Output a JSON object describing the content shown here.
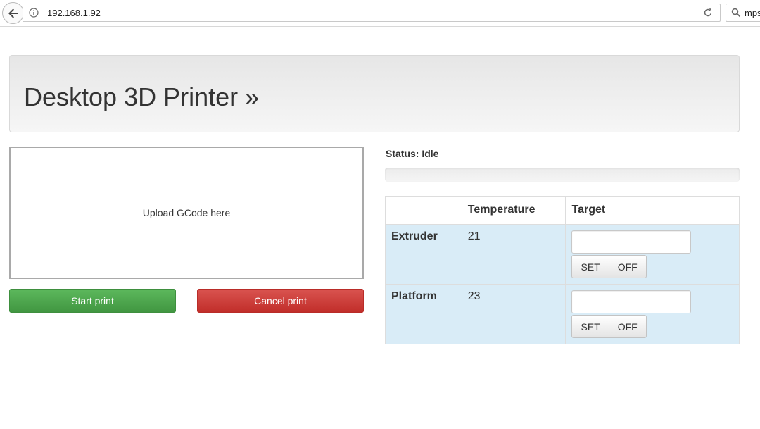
{
  "browser": {
    "url": "192.168.1.92",
    "search_text": "mps"
  },
  "header": {
    "title": "Desktop 3D Printer »"
  },
  "upload": {
    "label": "Upload GCode here"
  },
  "actions": {
    "start_label": "Start print",
    "cancel_label": "Cancel print"
  },
  "status": {
    "text": "Status: Idle",
    "progress_percent": 0
  },
  "table": {
    "headers": [
      "",
      "Temperature",
      "Target"
    ],
    "rows": [
      {
        "name": "Extruder",
        "temperature": "21",
        "target_value": "",
        "set_label": "SET",
        "off_label": "OFF"
      },
      {
        "name": "Platform",
        "temperature": "23",
        "target_value": "",
        "set_label": "SET",
        "off_label": "OFF"
      }
    ]
  },
  "colors": {
    "start": "#5cb85c",
    "cancel": "#d9534f",
    "row_info": "#d9ecf7"
  }
}
